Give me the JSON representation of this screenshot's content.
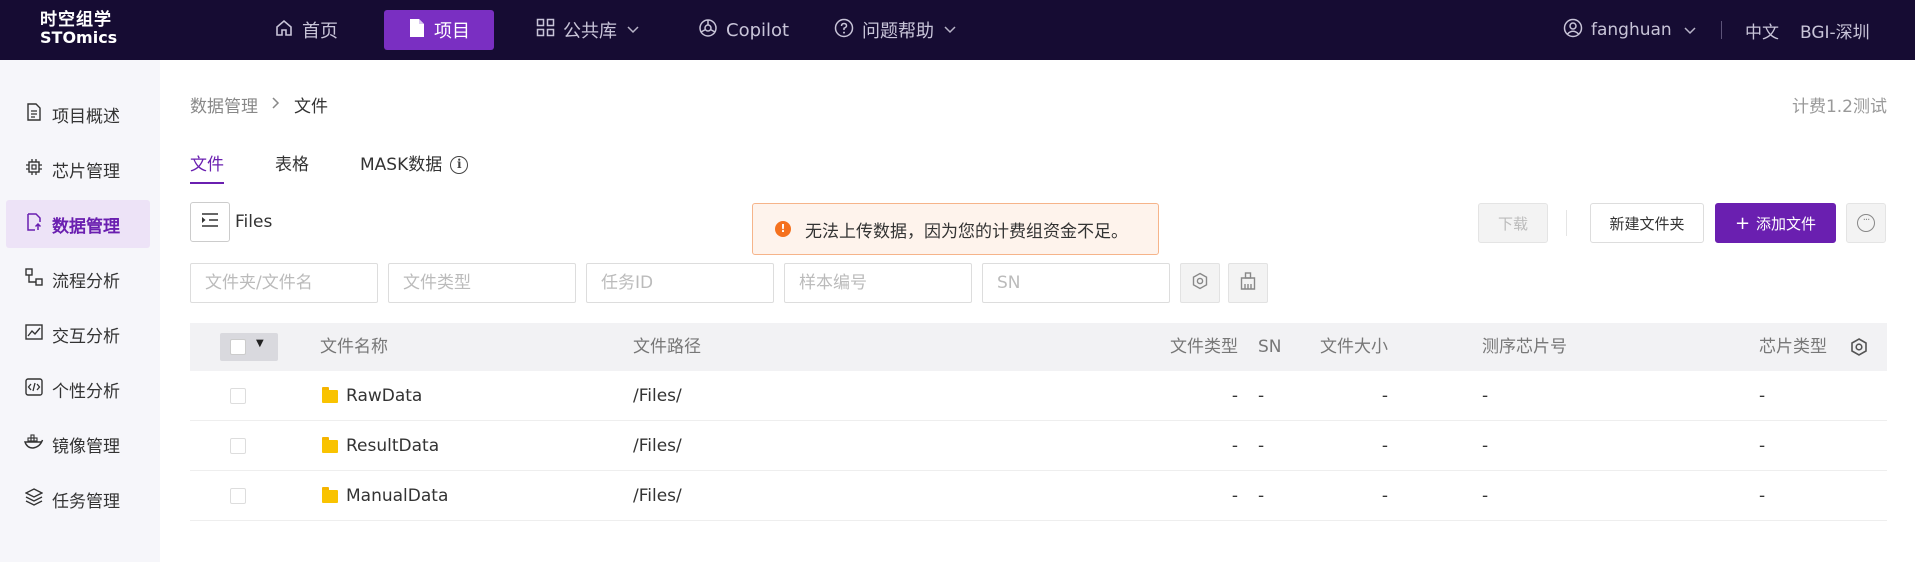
{
  "topbar": {
    "logo_line1": "时空组学",
    "logo_line2": "STOmics",
    "nav": [
      {
        "label": "首页"
      },
      {
        "label": "项目"
      },
      {
        "label": "公共库"
      },
      {
        "label": "Copilot"
      },
      {
        "label": "问题帮助"
      }
    ],
    "user": "fanghuan",
    "language": "中文",
    "region": "BGI-深圳"
  },
  "sidebar": {
    "items": [
      {
        "label": "项目概述"
      },
      {
        "label": "芯片管理"
      },
      {
        "label": "数据管理"
      },
      {
        "label": "流程分析"
      },
      {
        "label": "交互分析"
      },
      {
        "label": "个性分析"
      },
      {
        "label": "镜像管理"
      },
      {
        "label": "任务管理"
      }
    ]
  },
  "breadcrumb": {
    "parent": "数据管理",
    "current": "文件"
  },
  "billing_group": "计费1.2测试",
  "tabs": [
    {
      "label": "文件"
    },
    {
      "label": "表格"
    },
    {
      "label": "MASK数据"
    }
  ],
  "files_label": "Files",
  "toast": {
    "message": "无法上传数据，因为您的计费组资金不足。"
  },
  "toolbar": {
    "download": "下载",
    "new_folder": "新建文件夹",
    "add_file": "添加文件"
  },
  "filters": {
    "name": "文件夹/文件名",
    "type": "文件类型",
    "task_id": "任务ID",
    "sample": "样本编号",
    "sn": "SN"
  },
  "table": {
    "headers": {
      "name": "文件名称",
      "path": "文件路径",
      "type": "文件类型",
      "size": "文件大小",
      "sn": "SN",
      "seq_chip": "测序芯片号",
      "chip_type": "芯片类型"
    },
    "rows": [
      {
        "name": "RawData",
        "path": "/Files/",
        "type": "-",
        "size": "-",
        "sn": "-",
        "seq_chip": "-",
        "chip_type": "-"
      },
      {
        "name": "ResultData",
        "path": "/Files/",
        "type": "-",
        "size": "-",
        "sn": "-",
        "seq_chip": "-",
        "chip_type": "-"
      },
      {
        "name": "ManualData",
        "path": "/Files/",
        "type": "-",
        "size": "-",
        "sn": "-",
        "seq_chip": "-",
        "chip_type": "-"
      }
    ]
  },
  "colors": {
    "topbar_bg": "#160c33",
    "accent": "#6a1fb0",
    "warning": "#f5711e"
  }
}
